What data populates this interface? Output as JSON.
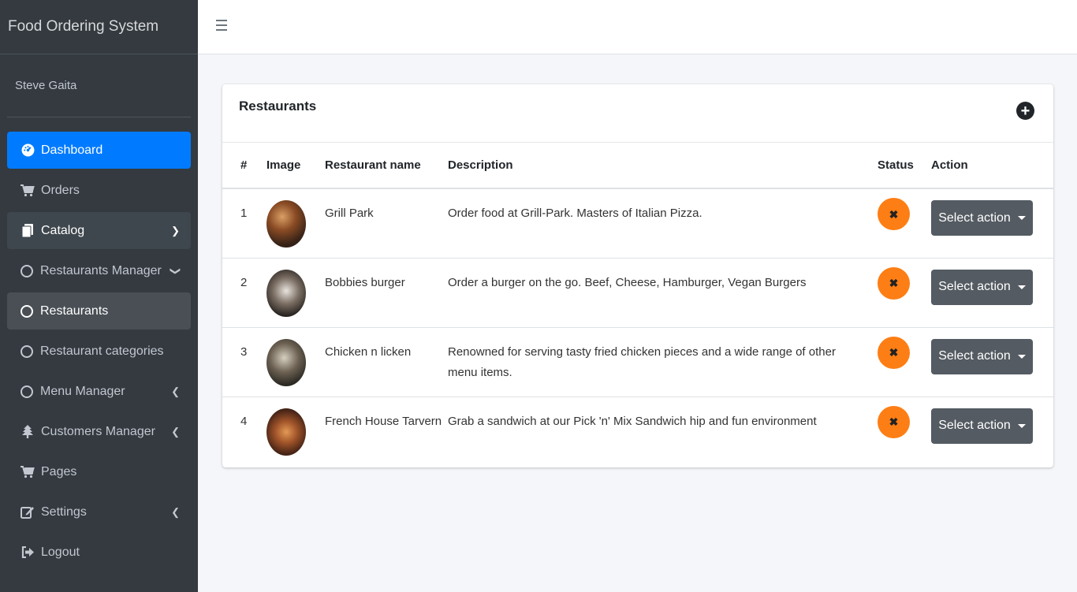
{
  "app": {
    "brand": "Food Ordering System",
    "user": "Steve Gaita"
  },
  "sidebar": {
    "items": [
      {
        "label": "Dashboard",
        "icon": "tachometer-icon"
      },
      {
        "label": "Orders",
        "icon": "cart-icon"
      },
      {
        "label": "Catalog",
        "icon": "copy-icon"
      },
      {
        "label": "Restaurants Manager",
        "icon": "circle-icon"
      },
      {
        "label": "Restaurants",
        "icon": "circle-icon"
      },
      {
        "label": "Restaurant categories",
        "icon": "circle-icon"
      },
      {
        "label": "Menu Manager",
        "icon": "circle-icon"
      },
      {
        "label": "Customers Manager",
        "icon": "tree-icon"
      },
      {
        "label": "Pages",
        "icon": "cart-icon"
      },
      {
        "label": "Settings",
        "icon": "edit-icon"
      },
      {
        "label": "Logout",
        "icon": "sign-out-icon"
      }
    ]
  },
  "main": {
    "card_title": "Restaurants",
    "table": {
      "headers": [
        "#",
        "Image",
        "Restaurant name",
        "Description",
        "Status",
        "Action"
      ],
      "rows": [
        {
          "num": "1",
          "name": "Grill Park",
          "description": "Order food at Grill-Park. Masters of Italian Pizza.",
          "action": "Select action"
        },
        {
          "num": "2",
          "name": "Bobbies burger",
          "description": "Order a burger on the go. Beef, Cheese, Hamburger, Vegan Burgers",
          "action": "Select action"
        },
        {
          "num": "3",
          "name": "Chicken n licken",
          "description": "Renowned for serving tasty fried chicken pieces and a wide range of other menu items.",
          "action": "Select action"
        },
        {
          "num": "4",
          "name": "French House Tarvern",
          "description": "Grab a sandwich at our Pick 'n' Mix Sandwich hip and fun environment",
          "action": "Select action"
        }
      ]
    }
  },
  "colors": {
    "sidebar_bg": "#343a40",
    "active": "#007bff",
    "status": "#fd7e14",
    "action_btn": "#545b62"
  }
}
